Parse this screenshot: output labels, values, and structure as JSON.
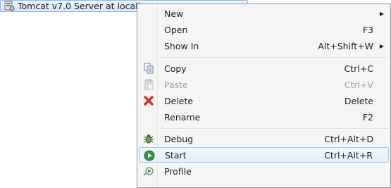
{
  "tree": {
    "label": "Tomcat v7.0 Server at localh"
  },
  "menu": {
    "items": [
      {
        "label": "New",
        "shortcut": "",
        "submenu": true
      },
      {
        "label": "Open",
        "shortcut": "F3"
      },
      {
        "label": "Show In",
        "shortcut": "Alt+Shift+W",
        "submenu": true
      },
      {
        "label": "Copy",
        "shortcut": "Ctrl+C",
        "icon": "copy-icon"
      },
      {
        "label": "Paste",
        "shortcut": "Ctrl+V",
        "icon": "paste-icon",
        "disabled": true
      },
      {
        "label": "Delete",
        "shortcut": "Delete",
        "icon": "delete-icon"
      },
      {
        "label": "Rename",
        "shortcut": "F2"
      },
      {
        "label": "Debug",
        "shortcut": "Ctrl+Alt+D",
        "icon": "debug-icon"
      },
      {
        "label": "Start",
        "shortcut": "Ctrl+Alt+R",
        "icon": "start-icon",
        "highlighted": true
      },
      {
        "label": "Profile",
        "shortcut": "",
        "icon": "profile-icon"
      }
    ]
  },
  "colors": {
    "highlight_border": "#a8c6ec",
    "delete_red": "#d9302a",
    "start_green": "#2f9a3c"
  }
}
